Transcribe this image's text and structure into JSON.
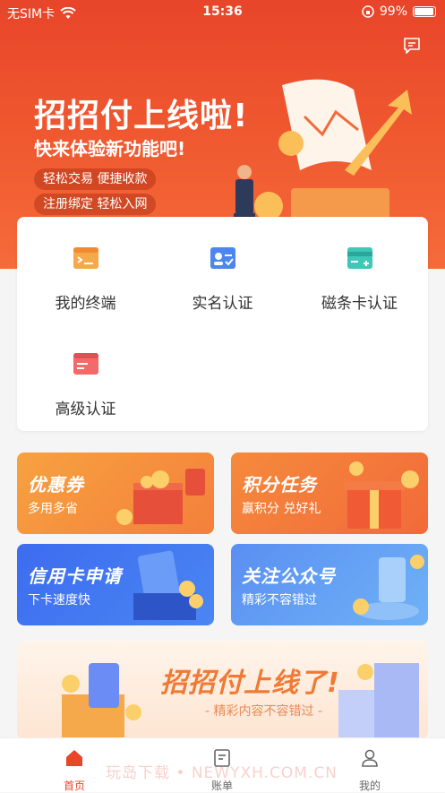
{
  "status": {
    "carrier": "无SIM卡",
    "time": "15:36",
    "battery": "99%"
  },
  "hero": {
    "title": "招招付上线啦!",
    "subtitle": "快来体验新功能吧!",
    "tags": [
      "轻松交易 便捷收款",
      "注册绑定 轻松入网"
    ]
  },
  "menu": [
    {
      "label": "我的终端",
      "icon": "terminal-icon",
      "color": "#f5a94a"
    },
    {
      "label": "实名认证",
      "icon": "id-card-icon",
      "color": "#4d86f0"
    },
    {
      "label": "磁条卡认证",
      "icon": "magstripe-card-icon",
      "color": "#3fc7b8"
    },
    {
      "label": "高级认证",
      "icon": "advanced-card-icon",
      "color": "#f26a6a"
    }
  ],
  "promos": [
    {
      "title": "优惠券",
      "desc": "多用多省"
    },
    {
      "title": "积分任务",
      "desc": "赢积分 兑好礼"
    },
    {
      "title": "信用卡申请",
      "desc": "下卡速度快"
    },
    {
      "title": "关注公众号",
      "desc": "精彩不容错过"
    }
  ],
  "banner": {
    "title": "招招付上线了!",
    "subtitle": "- 精彩内容不容错过 -"
  },
  "watermark": "玩岛下载 • NEWYXH.COM.CN",
  "tabs": [
    {
      "label": "首页",
      "icon": "home-icon"
    },
    {
      "label": "账单",
      "icon": "bill-icon"
    },
    {
      "label": "我的",
      "icon": "profile-icon"
    }
  ],
  "colors": {
    "brand": "#e8452a",
    "accent": "#f07a34"
  }
}
